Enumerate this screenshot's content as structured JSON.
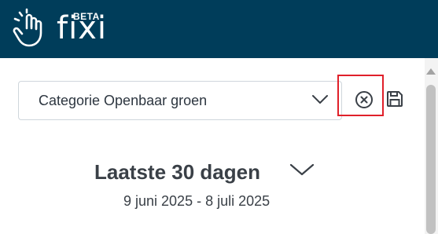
{
  "header": {
    "logo_text": "fixi",
    "badge": "BETA",
    "logo_icon": "hand-icon",
    "background": "#003d5a"
  },
  "filter": {
    "category_value": "Categorie Openbaar groen",
    "dropdown_icon": "chevron-down-icon",
    "clear_icon": "close-circle-icon",
    "save_icon": "save-icon",
    "highlight_color": "#e0202a"
  },
  "period": {
    "title": "Laatste 30 dagen",
    "range": "9 juni 2025 - 8 juli 2025",
    "toggle_icon": "chevron-down-icon"
  },
  "colors": {
    "text": "#3a4047",
    "border": "#cfd6dc"
  }
}
